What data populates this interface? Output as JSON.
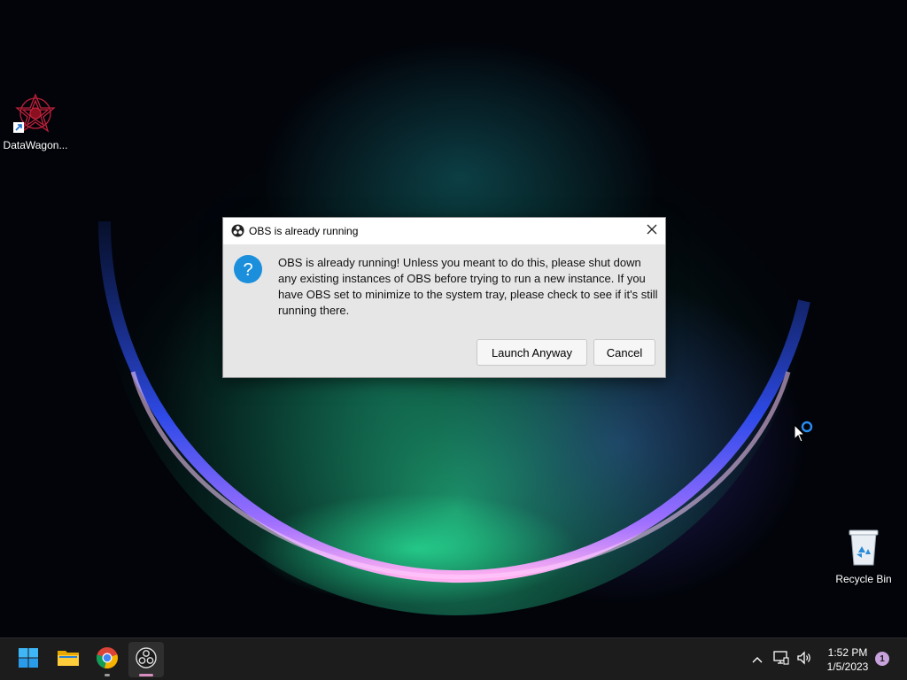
{
  "desktop": {
    "icons": [
      {
        "label": "DataWagon...",
        "icon": "datawagon-app-icon"
      },
      {
        "label": "Recycle Bin",
        "icon": "recycle-bin-icon"
      }
    ]
  },
  "dialog": {
    "title": "OBS is already running",
    "app_icon": "obs-icon",
    "type_icon": "question-icon",
    "message": "OBS is already running! Unless you meant to do this, please shut down any existing instances of OBS before trying to run a new instance. If you have OBS set to minimize to the system tray, please check to see if it's still running there.",
    "buttons": {
      "launch_label": "Launch Anyway",
      "cancel_label": "Cancel"
    }
  },
  "taskbar": {
    "apps": [
      {
        "name": "Start",
        "icon": "windows-start-icon"
      },
      {
        "name": "File Explorer",
        "icon": "folder-icon"
      },
      {
        "name": "Google Chrome",
        "icon": "chrome-icon",
        "running": true
      },
      {
        "name": "OBS Studio",
        "icon": "obs-icon",
        "running": true,
        "active": true
      }
    ],
    "tray": {
      "icons": [
        "chevron-up-icon",
        "network-icon",
        "volume-icon"
      ],
      "time": "1:52 PM",
      "date": "1/5/2023",
      "notification_count": "1"
    }
  },
  "colors": {
    "dialog_background": "#e6e6e6",
    "titlebar_background": "#ffffff",
    "taskbar_background": "#1c1c1c",
    "question_icon": "#1c8fdc",
    "active_indicator": "#d78ebf"
  }
}
